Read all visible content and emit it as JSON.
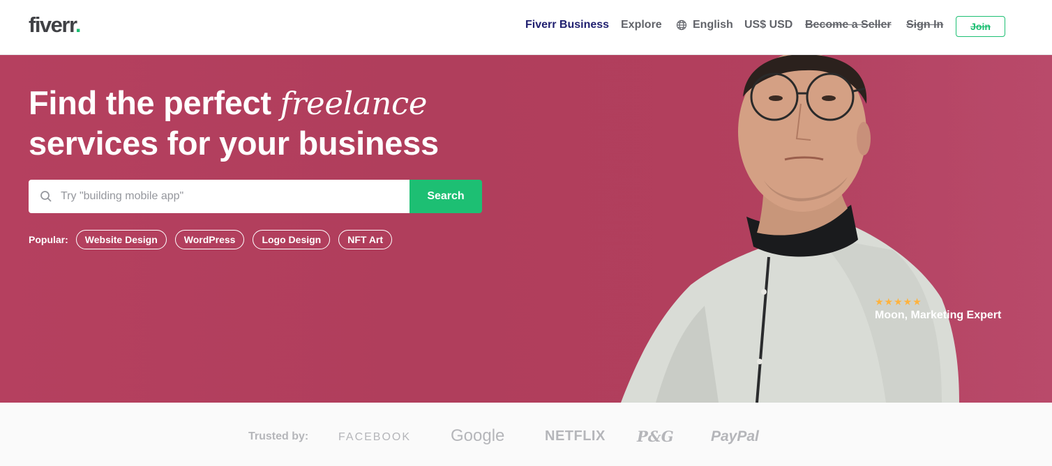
{
  "header": {
    "logo_text": "fiverr",
    "logo_dot": ".",
    "nav": {
      "business": "Fiverr Business",
      "explore": "Explore",
      "language": "English",
      "currency": "US$ USD",
      "seller": "Become a Seller",
      "signin": "Sign In",
      "join": "Join"
    }
  },
  "hero": {
    "headline_part1": "Find the perfect ",
    "headline_em": "freelance",
    "headline_part2": "services for your business",
    "search": {
      "placeholder": "Try \"building mobile app\"",
      "button": "Search"
    },
    "popular_label": "Popular:",
    "popular": [
      "Website Design",
      "WordPress",
      "Logo Design",
      "NFT Art"
    ],
    "rating_stars": "★★★★★",
    "caption": "Moon, Marketing Expert"
  },
  "trusted": {
    "label": "Trusted by:",
    "brands": [
      "FACEBOOK",
      "Google",
      "NETFLIX",
      "P&G",
      "PayPal"
    ]
  },
  "colors": {
    "brand_green": "#1dbf73",
    "hero_bg": "#b03e5c",
    "business_nav": "#1f1f6f"
  },
  "icons": {
    "language": "globe-icon",
    "search": "search-icon"
  }
}
